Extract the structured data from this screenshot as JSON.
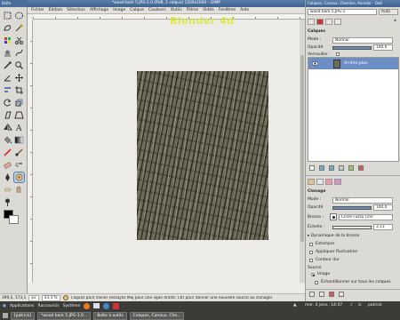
{
  "toolbox": {
    "title": "Boîte"
  },
  "image_window": {
    "title": "*wood bark 5.JPG-1.0 (RVB, 1 calque) 1200x1600 – GIMP",
    "menus": [
      "Fichier",
      "Édition",
      "Sélection",
      "Affichage",
      "Image",
      "Calque",
      "Couleurs",
      "Outils",
      "Filtres",
      "Vidéo",
      "Fenêtres",
      "Aide"
    ],
    "watermark": "Blender 4d"
  },
  "status": {
    "coords": "399,5, 573,1",
    "unit": "px",
    "zoom": "33,3 %",
    "message": "Cliquez pour cloner (essayez Maj pour une ligne droite, Ctrl pour donner une nouvelle source au clonage)"
  },
  "dock": {
    "title": "Calques, Canaux, Chemins, Annuler - Outi",
    "image_select": "wood bark 5.JPG-1",
    "auto_label": "Auto",
    "layers": {
      "header": "Calques",
      "mode_label": "Mode :",
      "mode_value": "Normal",
      "opacity_label": "Opacité",
      "opacity_value": "100,0",
      "lock_label": "Verrouiller :",
      "layer_name": "Arrière-plan"
    },
    "clone": {
      "header": "Clonage",
      "mode_label": "Mode :",
      "mode_value": "Normal",
      "opacity_label": "Opacité",
      "opacity_value": "100,0",
      "brush_label": "Brosse :",
      "brush_value": "Circle Fuzzy (19)",
      "scale_label": "Échelle :",
      "scale_value": "3,13",
      "dynamics_label": "Dynamique de la brosse",
      "opt_estomper": "Estomper",
      "opt_fluctuation": "Appliquer fluctuation",
      "opt_contour": "Contour dur",
      "source_label": "Source",
      "source_image": "Image",
      "sample_merged": "Échantillonner sur tous les calques"
    }
  },
  "taskbar": {
    "menus": [
      "Applications",
      "Raccourcis",
      "Système"
    ],
    "tasks": [
      "[patrick]",
      "*wood bark 5.JPG-1.0...",
      "Boîte à outils",
      "Calques, Canaux, Che..."
    ],
    "clock": "mar. 4 janv., 14:47",
    "user": "patrick"
  },
  "colors": {
    "title_blue": "#4a6e9c",
    "watermark": "#dce628",
    "selection_blue": "#6c8ec4"
  }
}
